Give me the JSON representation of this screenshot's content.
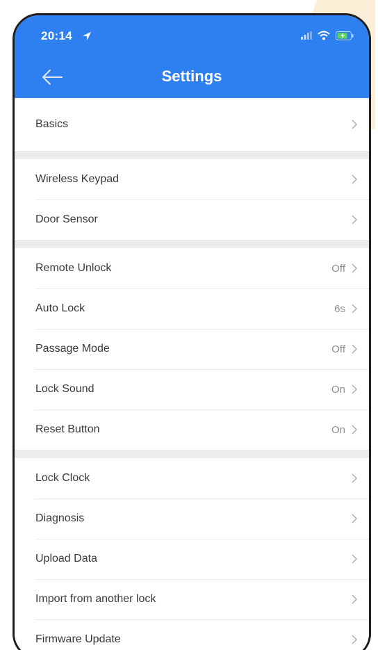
{
  "status_bar": {
    "time": "20:14"
  },
  "header": {
    "title": "Settings"
  },
  "groups": [
    {
      "items": [
        {
          "label": "Basics",
          "value": ""
        }
      ]
    },
    {
      "items": [
        {
          "label": "Wireless Keypad",
          "value": ""
        },
        {
          "label": "Door Sensor",
          "value": ""
        }
      ]
    },
    {
      "items": [
        {
          "label": "Remote Unlock",
          "value": "Off"
        },
        {
          "label": "Auto Lock",
          "value": "6s"
        },
        {
          "label": "Passage Mode",
          "value": "Off"
        },
        {
          "label": "Lock Sound",
          "value": "On"
        },
        {
          "label": "Reset Button",
          "value": "On"
        }
      ]
    },
    {
      "items": [
        {
          "label": "Lock Clock",
          "value": ""
        },
        {
          "label": "Diagnosis",
          "value": ""
        },
        {
          "label": "Upload Data",
          "value": ""
        },
        {
          "label": "Import from another lock",
          "value": ""
        },
        {
          "label": "Firmware Update",
          "value": ""
        }
      ]
    }
  ],
  "colors": {
    "header_bg": "#2e7ff0",
    "background": "#ececec",
    "text": "#3a3a3a",
    "value_text": "#8e8e8e"
  }
}
